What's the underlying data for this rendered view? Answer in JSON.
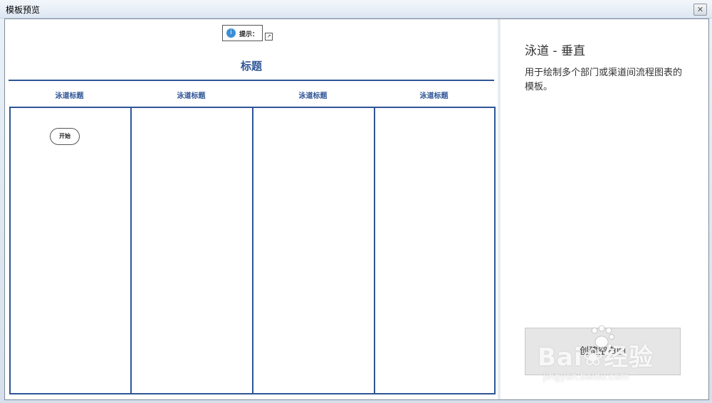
{
  "window": {
    "title": "模板预览",
    "close_glyph": "✕"
  },
  "preview": {
    "hint_icon_glyph": "i",
    "hint_label": "提示：",
    "edit_glyph": "↗",
    "diagram_title": "标题",
    "lane_headers": [
      "泳道标题",
      "泳道标题",
      "泳道标题",
      "泳道标题"
    ],
    "start_shape": "开始"
  },
  "info": {
    "template_name": "泳道 - 垂直",
    "description": "用于绘制多个部门或渠道间流程图表的模板。",
    "create_button": "创建空白图"
  },
  "watermark": {
    "main": "Bai❀经验",
    "sub": "jingyan.baidu.com"
  }
}
